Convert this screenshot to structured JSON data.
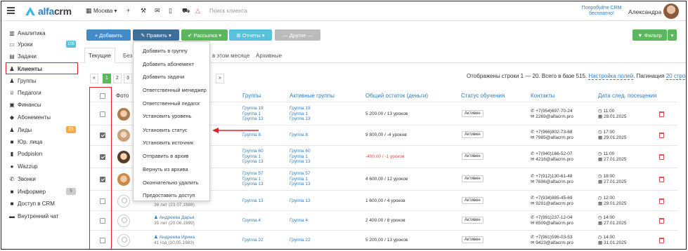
{
  "header": {
    "logo_text": "alfacrm",
    "branch": "Москва",
    "search_placeholder": "Поиск клиента",
    "promo": "Попробуйте CRM бесплатно!",
    "user_name": "Александра"
  },
  "sidebar": {
    "items": [
      {
        "label": "Аналитика",
        "icon": "chart-icon"
      },
      {
        "label": "Уроки",
        "icon": "calendar-icon",
        "badge": "105",
        "badge_color": "#5bc0de"
      },
      {
        "label": "Задачи",
        "icon": "tasks-icon"
      },
      {
        "label": "Клиенты",
        "icon": "user-icon"
      },
      {
        "label": "Группы",
        "icon": "group-icon"
      },
      {
        "label": "Педагоги",
        "icon": "teacher-icon"
      },
      {
        "label": "Финансы",
        "icon": "money-icon"
      },
      {
        "label": "Абонементы",
        "icon": "tag-icon"
      },
      {
        "label": "Лиды",
        "icon": "lead-icon",
        "badge": "23",
        "badge_color": "#f0ad4e"
      },
      {
        "label": "Юр. лица",
        "icon": "briefcase-icon"
      },
      {
        "label": "Podpislon",
        "icon": "doc-icon"
      },
      {
        "label": "Wazzup",
        "icon": "whatsapp-icon"
      },
      {
        "label": "Звонки",
        "icon": "phone-icon"
      },
      {
        "label": "Информер",
        "icon": "informer-icon",
        "badge": "5",
        "badge_color": "#ccc"
      },
      {
        "label": "Доступ в CRM",
        "icon": "lock-icon"
      },
      {
        "label": "Внутренний чат",
        "icon": "chat-icon"
      }
    ]
  },
  "toolbar": {
    "add": "+ Добавить",
    "edit": "✎ Править ▾",
    "mailing": "✔ Рассылка ▾",
    "reports": "⊞ Отчеты ▾",
    "other": "— Другое —",
    "filter": "▼ Фильтр",
    "colors": {
      "add": "#428bca",
      "edit": "#3e6f9c",
      "mailing": "#5cb85c",
      "reports": "#5bc0de",
      "other": "#bbbbbb",
      "filter": "#5cb85c"
    }
  },
  "tabs": [
    "Текущие",
    "Без",
    "в этом месяце",
    "Архивные"
  ],
  "pagination": {
    "pages": [
      "«",
      "1",
      "2",
      "3",
      "»"
    ],
    "info": "Отображены строки 1 — 20. Всего в базе 515.",
    "settings_link": "Настройка полей",
    "pagination_label": "Пагинация",
    "pagination_value": "20 строк"
  },
  "table": {
    "headers": {
      "photo": "Фото",
      "groups": "Группы",
      "active_groups": "Активные группы",
      "balance": "Общий остаток (деньги)",
      "status": "Статус обучения",
      "contacts": "Контакты",
      "next_visit": "Дата след. посещения"
    },
    "rows": [
      {
        "checked": false,
        "photo": "girl-1",
        "name": "",
        "age": "",
        "groups": [
          "Группа 19",
          "Группа 1",
          "Группа 13"
        ],
        "active_groups": [
          "Группа 19",
          "Группа 1",
          "Группа 13"
        ],
        "balance": "5 200,00 / 13 уроков",
        "negative": false,
        "status": "Активен",
        "phone": "+7(954)697-70-24",
        "email": "2269@alfacrm.pro",
        "time": "11:00",
        "date": "28.01.2025"
      },
      {
        "checked": true,
        "photo": "girl-2",
        "name": "",
        "age": "",
        "groups": [
          "Группа 8"
        ],
        "active_groups": [
          "Группа 8"
        ],
        "balance": "9 800,00 / -4 уроков",
        "negative": false,
        "status": "Активен",
        "phone": "+7(966)802-73-68",
        "email": "7985@alfacrm.pro",
        "time": "17:00",
        "date": "29.01.2025"
      },
      {
        "checked": true,
        "photo": "boy-1",
        "name": "",
        "age": "",
        "groups": [
          "Группа 60",
          "Группа 1",
          "Группа 13"
        ],
        "active_groups": [
          "Группа 60",
          "Группа 1",
          "Группа 13"
        ],
        "balance": "-400,00 / -1 уроков",
        "negative": true,
        "status": "Активен",
        "phone": "+7(940)166-52-07",
        "email": "4216@alfacrm.pro",
        "time": "11:00",
        "date": "27.01.2025"
      },
      {
        "checked": true,
        "photo": "boy-2",
        "name": "",
        "age": "",
        "groups": [
          "Группа 57",
          "Группа 1",
          "Группа 13"
        ],
        "active_groups": [
          "Группа 57",
          "Группа 1",
          "Группа 13"
        ],
        "balance": "4 600,00 / 12 уроков",
        "negative": false,
        "status": "Активен",
        "phone": "+7(912)130-61-48",
        "email": "7696@alfacrm.pro",
        "time": "18:00",
        "date": "27.01.2025"
      },
      {
        "checked": false,
        "photo": "empty",
        "name": "",
        "age": "36 лет (23.07.1988)",
        "groups": [
          "Группа 13"
        ],
        "active_groups": [
          "Группа 13"
        ],
        "balance": "1 600,00 / 4 уроков",
        "negative": false,
        "status": "Активен",
        "phone": "+7(934)885-45-69",
        "email": "9291@alfacrm.pro",
        "time": "12:00",
        "date": "29.01.2025"
      },
      {
        "checked": false,
        "photo": "empty",
        "name": "Андреева Дарья",
        "age": "35 лет (20.06.1989)",
        "groups": [
          "Группа 4"
        ],
        "active_groups": [
          "Группа 4"
        ],
        "balance": "2 400,00 / 8 уроков",
        "negative": false,
        "status": "Активен",
        "phone": "+7(991)237-12-04",
        "email": "6509@alfacrm.pro",
        "time": "14:00",
        "date": "27.01.2025"
      },
      {
        "checked": false,
        "photo": "empty",
        "name": "Андреева Ирина",
        "age": "41 год (10.05.1983)",
        "groups": [
          "Группа 22"
        ],
        "active_groups": [
          "Группа 22"
        ],
        "balance": "5 200,00 / 13 уроков",
        "negative": false,
        "status": "Активен",
        "phone": "+7(961)596-03-53",
        "email": "9423@alfacrm.pro",
        "time": "14:00",
        "date": "31.01.2025"
      }
    ]
  },
  "dropdown": {
    "items": [
      "Добавить в группу",
      "Добавить абонемент",
      "Добавить задачи",
      "Ответственный менеджер",
      "Ответственный педагог",
      "Установить уровень",
      "Установить статус",
      "Установить источник",
      "Отправить в архив",
      "Вернуть из архива",
      "Окончательно удалить",
      "Предоставить доступ"
    ]
  },
  "annotation": {
    "highlight_color": "#e0202a"
  }
}
